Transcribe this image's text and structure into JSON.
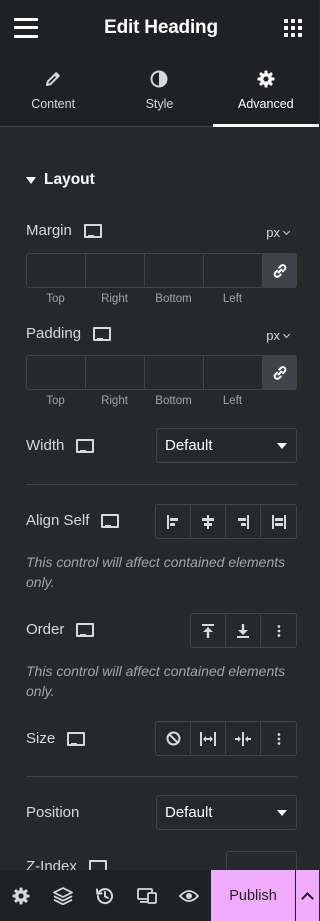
{
  "header": {
    "title": "Edit Heading"
  },
  "tabs": [
    {
      "label": "Content",
      "icon": "pencil-icon"
    },
    {
      "label": "Style",
      "icon": "half-circle-icon"
    },
    {
      "label": "Advanced",
      "icon": "gear-icon",
      "active": true
    }
  ],
  "section": {
    "title": "Layout"
  },
  "margin": {
    "label": "Margin",
    "unit": "px",
    "fields": [
      "Top",
      "Right",
      "Bottom",
      "Left"
    ]
  },
  "padding": {
    "label": "Padding",
    "unit": "px",
    "fields": [
      "Top",
      "Right",
      "Bottom",
      "Left"
    ]
  },
  "width": {
    "label": "Width",
    "value": "Default"
  },
  "align_self": {
    "label": "Align Self",
    "note": "This control will affect contained elements only."
  },
  "order": {
    "label": "Order",
    "note": "This control will affect contained elements only."
  },
  "size": {
    "label": "Size"
  },
  "position": {
    "label": "Position",
    "value": "Default"
  },
  "zindex": {
    "label": "Z-Index"
  },
  "footer": {
    "publish_label": "Publish"
  },
  "colors": {
    "background": "#26292c",
    "bar": "#1f2124",
    "border": "#3f444b",
    "publish": "#f0abfc",
    "muted": "#9da5ae"
  }
}
